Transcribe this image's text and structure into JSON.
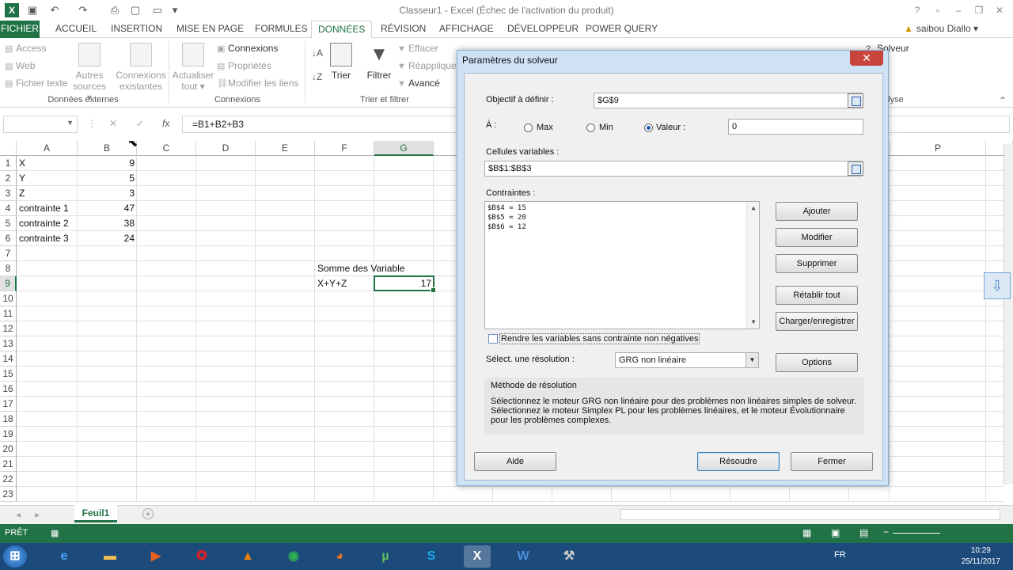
{
  "window": {
    "title": "Classeur1 - Excel (Échec de l'activation du produit)",
    "user": "saibou Diallo"
  },
  "tabs": [
    "FICHIER",
    "ACCUEIL",
    "INSERTION",
    "MISE EN PAGE",
    "FORMULES",
    "DONNÉES",
    "RÉVISION",
    "AFFICHAGE",
    "DÉVELOPPEUR",
    "POWER QUERY"
  ],
  "ribbon": {
    "external": {
      "access": "Access",
      "web": "Web",
      "text": "Fichier texte",
      "other_l1": "Autres",
      "other_l2": "sources",
      "existing_l1": "Connexions",
      "existing_l2": "existantes",
      "group": "Données externes"
    },
    "connections": {
      "refresh_l1": "Actualiser",
      "refresh_l2": "tout",
      "conn": "Connexions",
      "props": "Propriétés",
      "edit_links": "Modifier les liens",
      "group": "Connexions"
    },
    "sort": {
      "sort": "Trier",
      "filter": "Filtrer",
      "clear": "Effacer",
      "reapply": "Réappliquer",
      "advanced": "Avancé",
      "group": "Trier et filtrer"
    },
    "analysis": {
      "solver": "Solveur",
      "group_partial": "lyse"
    }
  },
  "formula": {
    "value": "=B1+B2+B3"
  },
  "grid": {
    "columns": [
      "A",
      "B",
      "C",
      "D",
      "E",
      "F",
      "G",
      "P"
    ],
    "rows": [
      "1",
      "2",
      "3",
      "4",
      "5",
      "6",
      "7",
      "8",
      "9",
      "10",
      "11",
      "12",
      "13",
      "14",
      "15",
      "16",
      "17",
      "18",
      "19",
      "20",
      "21",
      "22",
      "23"
    ],
    "a": [
      "X",
      "Y",
      "Z",
      "contrainte 1",
      "contrainte 2",
      "contrainte 3"
    ],
    "b": [
      "9",
      "5",
      "3",
      "47",
      "38",
      "24"
    ],
    "f8": "Somme des Variable",
    "f9": "X+Y+Z",
    "g9": "17"
  },
  "sheet": {
    "name": "Feuil1"
  },
  "status": {
    "ready": "PRÊT"
  },
  "taskbar": {
    "lang": "FR",
    "time": "10:29",
    "date": "25/11/2017"
  },
  "dialog": {
    "title": "Paramètres du solveur",
    "objective_label": "Objectif à définir :",
    "objective_value": "$G$9",
    "to_label": "À :",
    "max": "Max",
    "min": "Min",
    "value_label": "Valeur :",
    "value": "0",
    "vars_label": "Cellules variables :",
    "vars_value": "$B$1:$B$3",
    "constraints_label": "Contraintes :",
    "constraints": [
      "$B$4 = 15",
      "$B$5 = 20",
      "$B$6 = 12"
    ],
    "btn_add": "Ajouter",
    "btn_modify": "Modifier",
    "btn_delete": "Supprimer",
    "btn_reset": "Rétablir tout",
    "btn_load": "Charger/enregistrer",
    "nonneg": "Rendre les variables sans contrainte non négatives",
    "method_label": "Sélect. une résolution :",
    "method_value": "GRG non linéaire",
    "btn_options": "Options",
    "method_title": "Méthode de résolution",
    "method_desc_1": "Sélectionnez le moteur GRG non linéaire pour des problèmes non linéaires simples de solveur.",
    "method_desc_2": "Sélectionnez le moteur Simplex PL pour les problèmes linéaires, et le moteur Évolutionnaire",
    "method_desc_3": "pour les problèmes complexes.",
    "btn_help": "Aide",
    "btn_solve": "Résoudre",
    "btn_close": "Fermer"
  }
}
